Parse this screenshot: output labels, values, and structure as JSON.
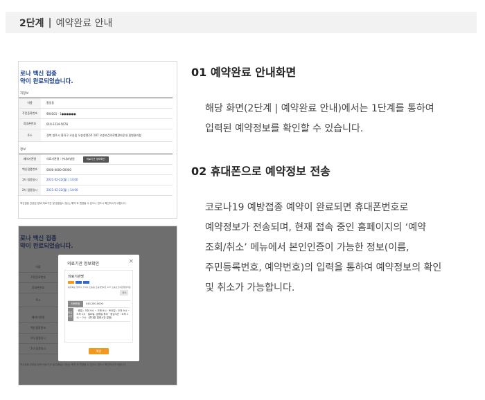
{
  "step_bar": {
    "step_no": "2단계",
    "separator": "|",
    "title": "예약완료 안내"
  },
  "section1": {
    "title": "01 예약완료 안내화면",
    "lines": [
      "해당 화면(2단계 | 예약완료 안내)에서는 1단계를 통하여",
      "입력된 예약정보를 확인할 수 있습니다."
    ]
  },
  "section2": {
    "title": "02 휴대폰으로 예약정보 전송",
    "lines": [
      "코로나19 예방접종 예약이 완료되면 휴대폰번호로",
      "예약정보가 전송되며, 현재 접속 중인 홈페이지의 ‘예약",
      "조회/취소’ 메뉴에서 본인인증이 가능한 정보(이름,",
      "주민등록번호, 예약번호)의 입력을 통하여 예약정보의 확인",
      "및 취소가 가능합니다."
    ]
  },
  "thumb1": {
    "heading_line1": "로나 백신 접종",
    "heading_line2": "약이 완료되었습니다.",
    "section_a": "자정보",
    "rows_a": [
      {
        "k": "이름",
        "v": "홍길동"
      },
      {
        "k": "주민등록번호",
        "v": "900101 - 1●●●●●●"
      },
      {
        "k": "휴대폰번호",
        "v": "010-1234-5678"
      },
      {
        "k": "주소",
        "v": "경북 청주시 흥덕구 오송읍 오송생명2로 187 오송보건의료행정타운내 질병관리청"
      }
    ],
    "section_b": "정보",
    "rows_b": [
      {
        "k": "예약기관명",
        "v": "의료기관명 : 위내과병원",
        "btn": "의료기관 정보확인"
      },
      {
        "k": "백신접종번호",
        "v": "0000-0000-00000"
      },
      {
        "k": "1차 접종일시",
        "v": "2021-02-22(월) | 14:00",
        "blue": true
      },
      {
        "k": "2차 접종일시",
        "v": "2021-02-22(월) | 14:00",
        "blue": true
      }
    ],
    "note": "백신접종 관련된 정보(의료기관 및 접종일시 등)는 예약 후 변경될 수 있으니 반드시 확인하시기 바랍니다."
  },
  "thumb2": {
    "heading_line1": "로나 백신 접종",
    "heading_line2": "약이 완료되었습니다.",
    "rows": [
      "이름",
      "주민등록번호",
      "휴대폰번호",
      "주소",
      "예약기관명",
      "백신접종번호",
      "1차 접종일시",
      "2차 접종일시"
    ],
    "modal_title": "의료기관 정보확인",
    "modal_name": "의료기관명",
    "modal_addr": "충청북도 청주시 흥덕구 오송읍 오송생명2로 187 오송보건의료행정타운",
    "modal_loc": "위치",
    "modal_rows": [
      {
        "k": "전화번호",
        "v": "043-200-0000"
      },
      {
        "k": "진료시간",
        "v": "· 평일 : 오전 9시 ~ 오후 6시 · 토요일 : 오전 9시 ~ 오후 1시 · 일요일, 공휴일 휴무 · 점심시간 : 오후 1시 ~ 2시 · (휴대폰 접종시간 없음)"
      }
    ],
    "modal_btn": "확인",
    "note": "백신접종 관련된 정보(의료기관 및 접종일시 등)는 예약 후 변경될 수 있으니 반드시 확인하시기 바랍니다."
  },
  "colors": {
    "heading_blue": "#1a3d8f",
    "date_blue": "#2a56b8",
    "confirm_orange": "#f39a1e",
    "step_bg": "#f2f2f2"
  }
}
